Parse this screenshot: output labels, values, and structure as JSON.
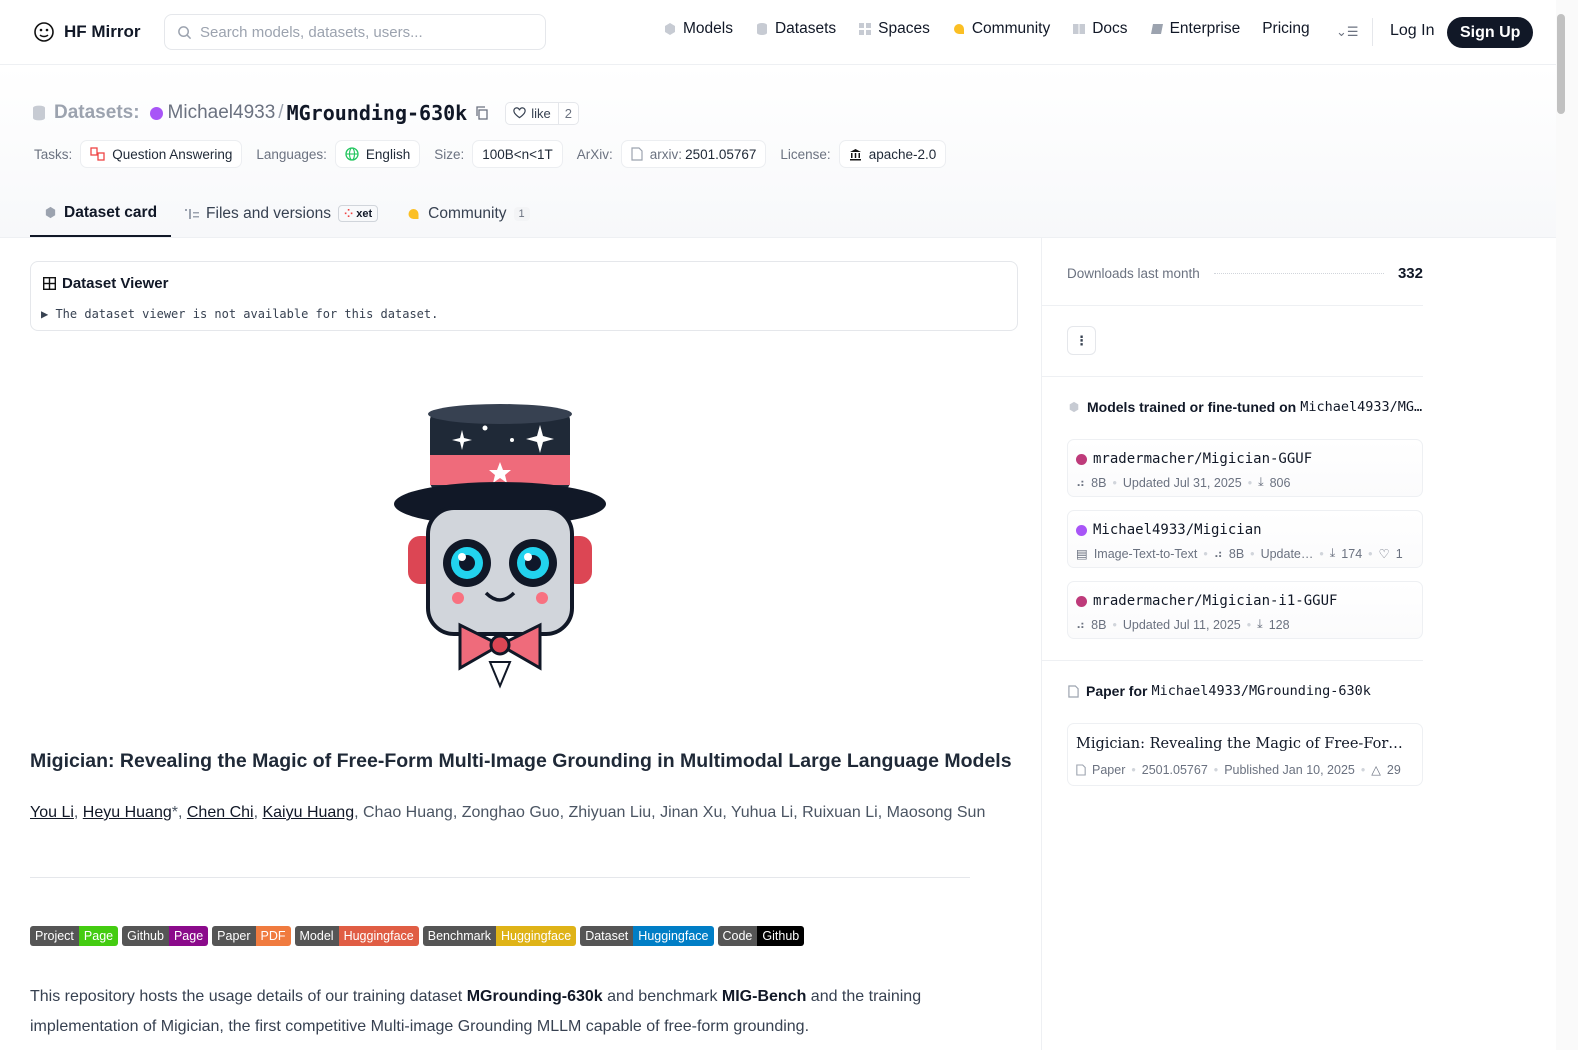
{
  "nav": {
    "brand": "HF Mirror",
    "search_placeholder": "Search models, datasets, users...",
    "links": [
      "Models",
      "Datasets",
      "Spaces",
      "Community",
      "Docs",
      "Enterprise",
      "Pricing"
    ],
    "login": "Log In",
    "signup": "Sign Up"
  },
  "header": {
    "prefix": "Datasets:",
    "owner": "Michael4933",
    "sep": "/",
    "repo": "MGrounding-630k",
    "like_label": "like",
    "like_count": "2",
    "tasks_label": "Tasks:",
    "task": "Question Answering",
    "languages_label": "Languages:",
    "language": "English",
    "size_label": "Size:",
    "size": "100B<n<1T",
    "arxiv_label": "ArXiv:",
    "arxiv_prefix": "arxiv:",
    "arxiv_id": "2501.05767",
    "license_label": "License:",
    "license": "apache-2.0"
  },
  "tabs": {
    "card": "Dataset card",
    "files": "Files and versions",
    "xet": "xet",
    "community": "Community",
    "community_count": "1"
  },
  "viewer": {
    "title": "Dataset Viewer",
    "message": "▶ The dataset viewer is not available for this dataset."
  },
  "content": {
    "paper_title": "Migician: Revealing the Magic of Free-Form Multi-Image Grounding in Multimodal Large Language Models",
    "authors_linked": [
      "You Li",
      "Heyu Huang",
      "Chen Chi",
      "Kaiyu Huang"
    ],
    "authors_rest": ", Chao Huang, Zonghao Guo, Zhiyuan Liu, Jinan Xu, Yuhua Li, Ruixuan Li, Maosong Sun",
    "shields": [
      {
        "k": "Project",
        "v": "Page",
        "color": "#4c1"
      },
      {
        "k": "Github",
        "v": "Page",
        "color": "#8b0a8b"
      },
      {
        "k": "Paper",
        "v": "PDF",
        "color": "#f07b3f"
      },
      {
        "k": "Model",
        "v": "Huggingface",
        "color": "#e05d44"
      },
      {
        "k": "Benchmark",
        "v": "Huggingface",
        "color": "#dfb317"
      },
      {
        "k": "Dataset",
        "v": "Huggingface",
        "color": "#007ec6"
      },
      {
        "k": "Code",
        "v": "Github",
        "color": "#000000"
      }
    ],
    "desc_1": "This repository hosts the usage details of our training dataset ",
    "desc_b1": "MGrounding-630k",
    "desc_2": " and benchmark ",
    "desc_b2": "MIG-Bench",
    "desc_3": " and the training implementation of Migician, the first competitive Multi-image Grounding MLLM capable of free-form grounding."
  },
  "sidebar": {
    "downloads_label": "Downloads last month",
    "downloads": "332",
    "models_heading": "Models trained or fine-tuned on",
    "models_repo": "Michael4933/MG…",
    "models": [
      {
        "name": "mradermacher/Migician-GGUF",
        "color": "#be3a7a",
        "params": "8B",
        "updated": "Updated Jul 31, 2025",
        "downloads": "806"
      },
      {
        "name": "Michael4933/Migician",
        "color": "#a855f7",
        "task": "Image-Text-to-Text",
        "params": "8B",
        "updated": "Update…",
        "downloads": "174",
        "likes": "1"
      },
      {
        "name": "mradermacher/Migician-i1-GGUF",
        "color": "#be3a7a",
        "params": "8B",
        "updated": "Updated Jul 11, 2025",
        "downloads": "128"
      }
    ],
    "paper_heading": "Paper for",
    "paper_repo": "Michael4933/MGrounding-630k",
    "paper_title": "Migician: Revealing the Magic of Free-Form Multi…",
    "paper_type": "Paper",
    "paper_id": "2501.05767",
    "paper_published": "Published Jan 10, 2025",
    "paper_upvotes": "29"
  }
}
